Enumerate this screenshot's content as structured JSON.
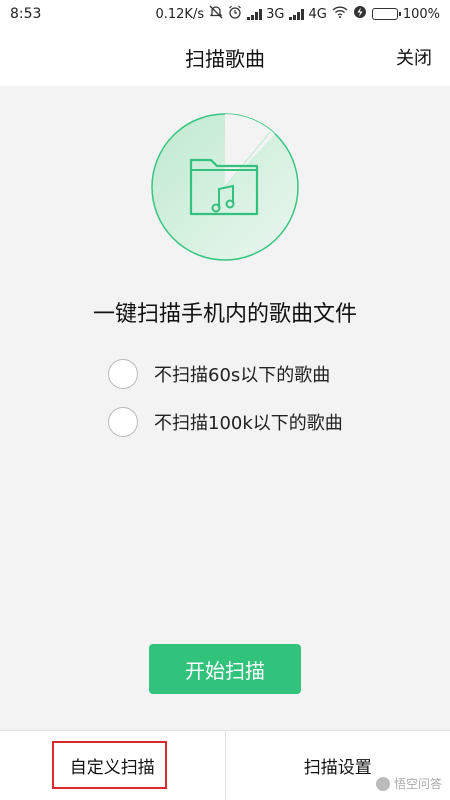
{
  "status_bar": {
    "time": "8:53",
    "net_speed": "0.12K/s",
    "network_3g": "3G",
    "network_4g": "4G",
    "battery_percent": "100%",
    "battery_level": 1.0
  },
  "header": {
    "title": "扫描歌曲",
    "close_label": "关闭"
  },
  "main": {
    "headline": "一键扫描手机内的歌曲文件",
    "options": [
      {
        "label": "不扫描60s以下的歌曲",
        "checked": false
      },
      {
        "label": "不扫描100k以下的歌曲",
        "checked": false
      }
    ],
    "start_label": "开始扫描"
  },
  "bottom_bar": {
    "custom_scan_label": "自定义扫描",
    "scan_settings_label": "扫描设置"
  },
  "watermark": "悟空问答",
  "colors": {
    "accent": "#31c27c",
    "highlight": "#d9282f",
    "background": "#f3f3f3"
  }
}
